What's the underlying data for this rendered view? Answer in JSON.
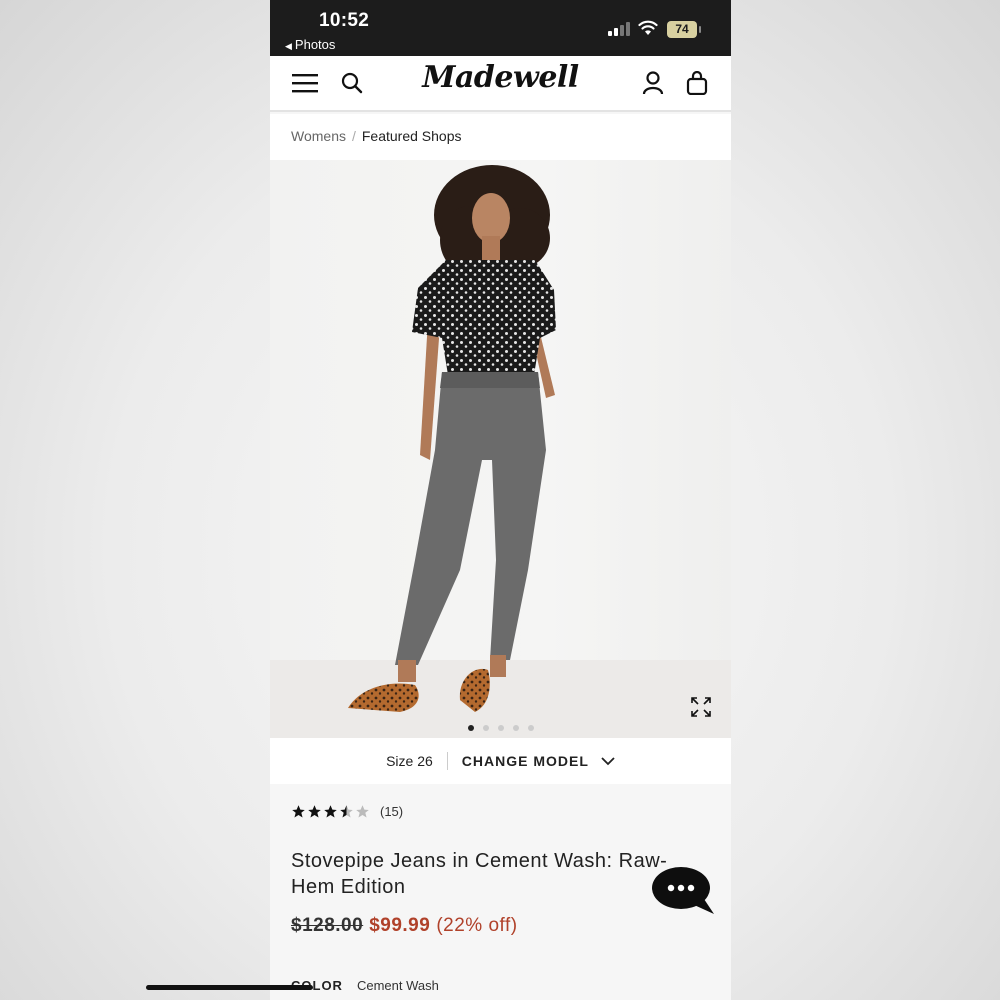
{
  "status_bar": {
    "time": "10:52",
    "back_label": "Photos",
    "battery": "74"
  },
  "header": {
    "logo": "Madewell",
    "icons": [
      "menu-icon",
      "search-icon",
      "account-icon",
      "bag-icon"
    ]
  },
  "breadcrumb": {
    "items": [
      "Womens",
      "Featured Shops"
    ],
    "separator": "/"
  },
  "gallery": {
    "image_count": 5,
    "active_index": 0,
    "expand_icon": "expand-icon"
  },
  "size_bar": {
    "size_label": "Size 26",
    "change_label": "CHANGE MODEL"
  },
  "product": {
    "rating": 3.5,
    "rating_max": 5,
    "review_count": "(15)",
    "title": "Stovepipe Jeans in Cement Wash: Raw-Hem Edition",
    "old_price": "$128.00",
    "sale_price": "$99.99",
    "discount": "(22% off)",
    "color_label": "COLOR",
    "color_value": "Cement Wash"
  },
  "colors": {
    "sale": "#b0412a",
    "status_bg": "#1c1c1c",
    "text": "#222222"
  }
}
